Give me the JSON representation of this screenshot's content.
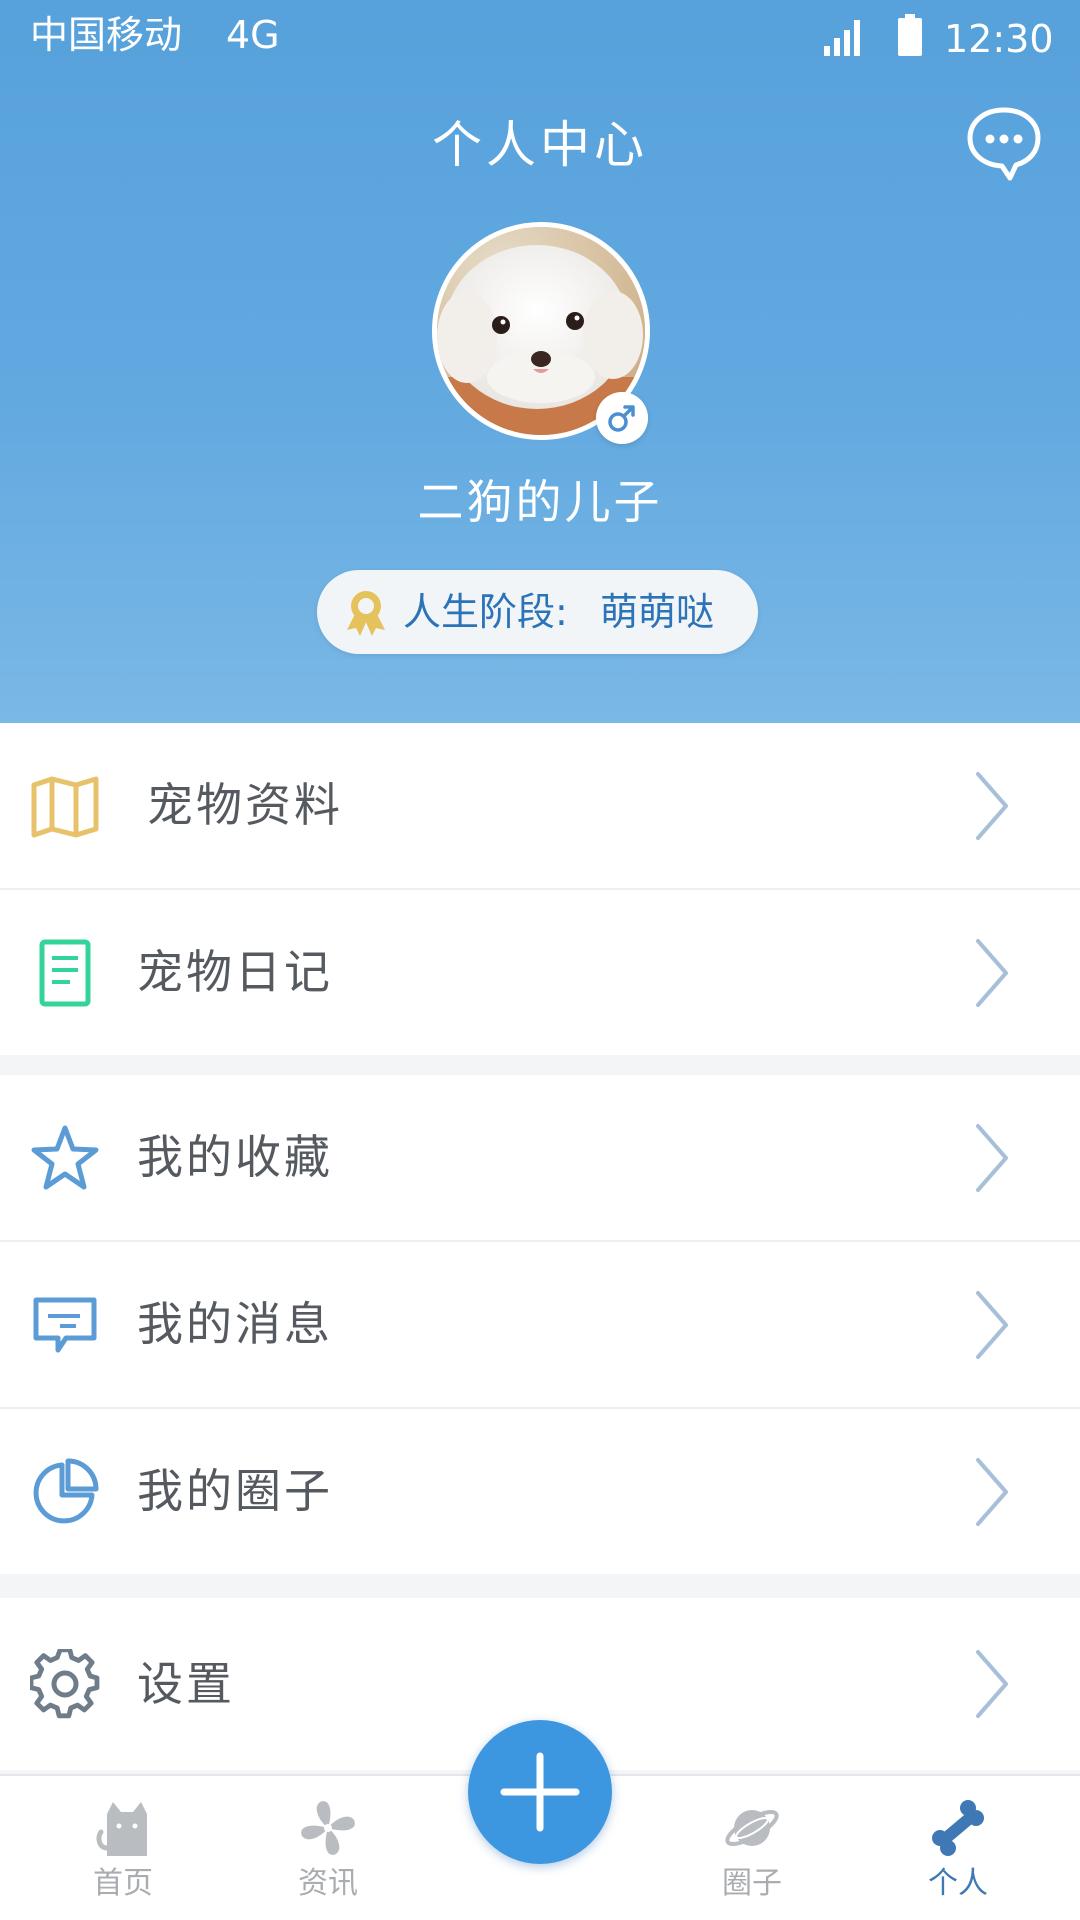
{
  "status_bar": {
    "carrier": "中国移动",
    "network": "4G",
    "time": "12:30",
    "icons": [
      "signal-icon",
      "battery-icon"
    ]
  },
  "header": {
    "title": "个人中心",
    "chat_icon": "chat-bubble-icon"
  },
  "profile": {
    "username": "二狗的儿子",
    "gender": "male",
    "gender_symbol": "♂",
    "stage_label": "人生阶段:",
    "stage_value": "萌萌哒",
    "medal_icon": "medal-icon"
  },
  "menu": {
    "groups": [
      {
        "items": [
          {
            "label": "宠物资料",
            "icon": "map-icon",
            "color": "#e7c26a"
          },
          {
            "label": "宠物日记",
            "icon": "notebook-icon",
            "color": "#34d39a"
          }
        ]
      },
      {
        "items": [
          {
            "label": "我的收藏",
            "icon": "star-icon",
            "color": "#5b9bd6"
          },
          {
            "label": "我的消息",
            "icon": "message-icon",
            "color": "#5b9bd6"
          },
          {
            "label": "我的圈子",
            "icon": "pie-chart-icon",
            "color": "#5b9bd6"
          }
        ]
      },
      {
        "items": [
          {
            "label": "设置",
            "icon": "gear-icon",
            "color": "#6f7d8a"
          }
        ]
      }
    ]
  },
  "bottom_nav": {
    "items": [
      {
        "label": "首页",
        "icon": "cat-icon",
        "active": false
      },
      {
        "label": "资讯",
        "icon": "pinwheel-icon",
        "active": false
      },
      {
        "label": "圈子",
        "icon": "planet-icon",
        "active": false
      },
      {
        "label": "个人",
        "icon": "bone-icon",
        "active": true
      }
    ],
    "fab_icon": "plus-icon"
  },
  "colors": {
    "header_top": "#57a1dc",
    "header_bottom": "#7ab8e6",
    "accent": "#3d97e0",
    "active_nav": "#3f78b5",
    "inactive_nav": "#a9adb1",
    "chevron": "#a7bfd8"
  }
}
